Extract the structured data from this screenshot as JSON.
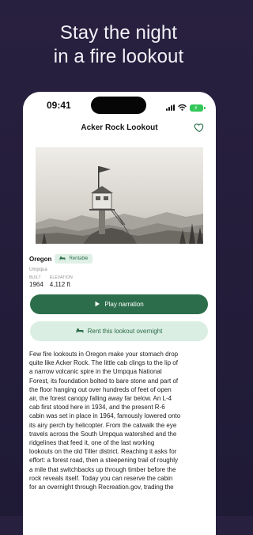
{
  "headline": {
    "line1": "Stay the night",
    "line2": "in a fire lookout"
  },
  "status_bar": {
    "time": "09:41"
  },
  "navigation": {
    "title": "Acker Rock Lookout"
  },
  "lookout": {
    "state": "Oregon",
    "badge": "Rentable",
    "forest": "Umpqua",
    "stats": [
      {
        "label": "BUILT",
        "value": "1964"
      },
      {
        "label": "ELEVATION",
        "value": "4,112 ft"
      }
    ]
  },
  "actions": {
    "play_narration": "Play narration",
    "rent_lookout": "Rent this lookout overnight"
  },
  "description_lines": [
    "Few fire lookouts in Oregon make your stomach drop",
    "quite like Acker Rock. The little cab clings to the lip of",
    "a narrow volcanic spire in the Umpqua National",
    "Forest, its foundation bolted to bare stone and part of",
    "the floor hanging out over hundreds of feet of open",
    "air, the forest canopy falling away far below. An L-4",
    "cab first stood here in 1934, and the present R-6",
    "cabin was set in place in 1964, famously lowered onto",
    "its airy perch by helicopter. From the catwalk the eye",
    "travels across the South Umpqua watershed and the",
    "ridgelines that feed it, one of the last working",
    "lookouts on the old Tiller district. Reaching it asks for",
    "effort: a forest road, then a steepening trail of roughly",
    "a mile that switchbacks up through timber before the",
    "rock reveals itself. Today you can reserve the cabin",
    "for an overnight through Recreation.gov, trading the"
  ],
  "colors": {
    "background": "#28203f",
    "accent": "#2c6e4b",
    "accent_light": "#dbeee3",
    "badge_bg": "#dff0e6",
    "battery": "#33c759"
  },
  "icons": {
    "favorite": "heart-icon",
    "play": "play-icon",
    "bed": "bed-icon",
    "wifi": "wifi-icon",
    "battery": "battery-icon"
  }
}
